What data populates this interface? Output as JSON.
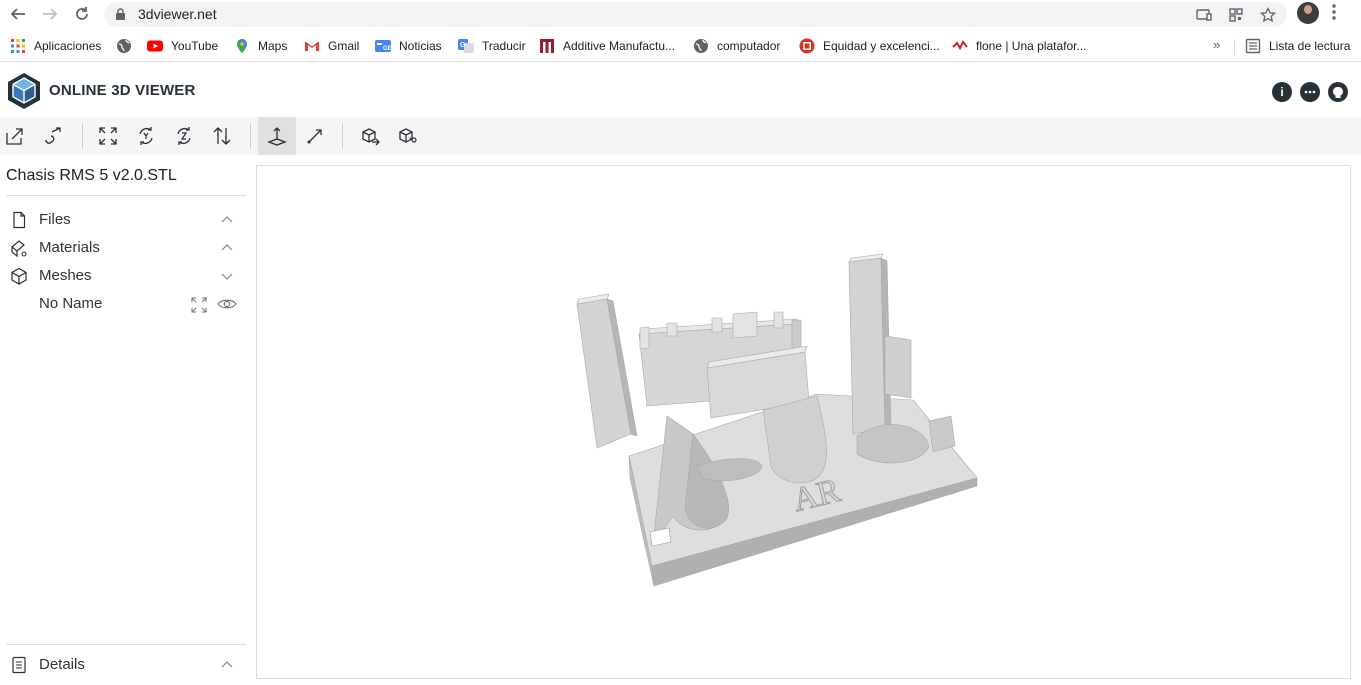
{
  "browser": {
    "url": "3dviewer.net",
    "bookmarks": [
      {
        "label": "Aplicaciones",
        "icon": "apps-grid-icon",
        "color": "#4285f4"
      },
      {
        "label": "",
        "icon": "globe-icon",
        "color": "#5f6368"
      },
      {
        "label": "YouTube",
        "icon": "youtube-icon",
        "color": "#ff0000"
      },
      {
        "label": "Maps",
        "icon": "maps-pin-icon",
        "color": "#34a853"
      },
      {
        "label": "Gmail",
        "icon": "gmail-icon",
        "color": "#ea4335"
      },
      {
        "label": "Noticias",
        "icon": "news-icon",
        "color": "#4285f4"
      },
      {
        "label": "Traducir",
        "icon": "translate-icon",
        "color": "#4285f4"
      },
      {
        "label": "Additive Manufactu...",
        "icon": "bookmark-am-icon",
        "color": "#9b1c2e"
      },
      {
        "label": "computador",
        "icon": "globe-icon",
        "color": "#5f6368"
      },
      {
        "label": "Equidad y excelenci...",
        "icon": "bookmark-red-circle-icon",
        "color": "#d93025"
      },
      {
        "label": "flone | Una platafor...",
        "icon": "flone-icon",
        "color": "#c62828"
      }
    ],
    "more_label": "»",
    "reading_list_label": "Lista de lectura"
  },
  "app": {
    "title": "ONLINE 3D VIEWER",
    "header_icons": [
      "info-icon",
      "feedback-icon",
      "github-icon"
    ]
  },
  "toolbar": {
    "buttons": [
      {
        "name": "open-file-icon",
        "group": 1
      },
      {
        "name": "open-url-icon",
        "group": 1
      },
      {
        "name": "fit-to-window-icon",
        "group": 2
      },
      {
        "name": "set-up-y-icon",
        "group": 2
      },
      {
        "name": "set-up-z-icon",
        "group": 2
      },
      {
        "name": "flip-up-icon",
        "group": 2
      },
      {
        "name": "fixed-up-vector-icon",
        "group": 3,
        "active": true
      },
      {
        "name": "free-orbit-icon",
        "group": 3
      },
      {
        "name": "export-icon",
        "group": 4
      },
      {
        "name": "share-icon",
        "group": 4
      }
    ]
  },
  "panel": {
    "model_name": "Chasis RMS 5 v2.0.STL",
    "sections": [
      {
        "label": "Files",
        "icon": "file-icon",
        "state": "collapsed"
      },
      {
        "label": "Materials",
        "icon": "materials-icon",
        "state": "collapsed"
      },
      {
        "label": "Meshes",
        "icon": "meshes-icon",
        "state": "expanded"
      }
    ],
    "mesh_item": "No Name",
    "details_label": "Details"
  },
  "colors": {
    "model_light": "#d9d9d9",
    "model_mid": "#bdbdbd",
    "model_dark": "#9e9e9e",
    "toolbar_bg": "#f5f5f5",
    "brand": "#263238"
  }
}
